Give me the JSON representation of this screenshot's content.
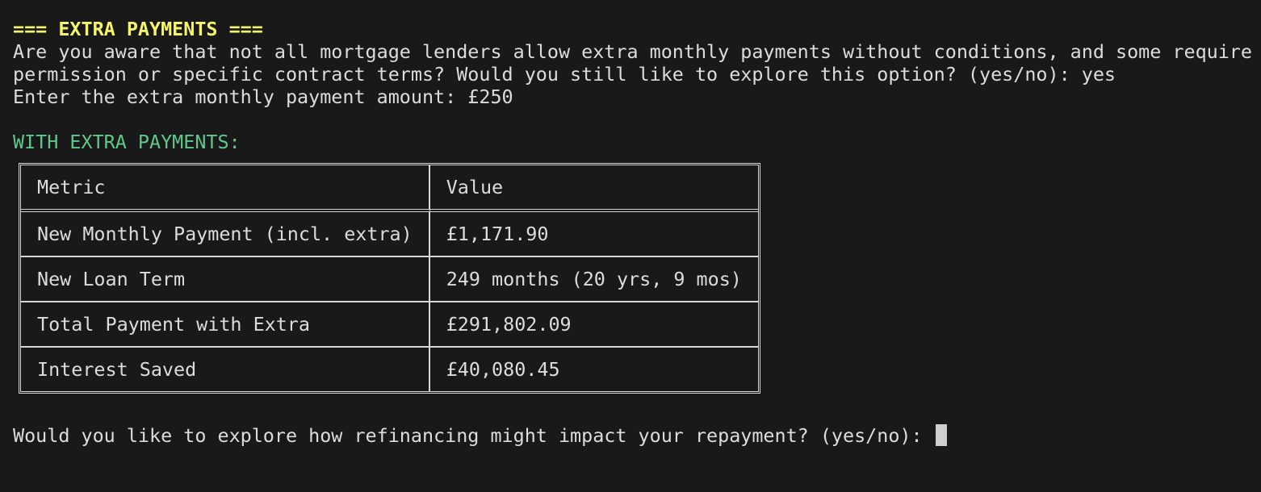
{
  "terminal": {
    "heading": "=== EXTRA PAYMENTS ===",
    "question_line1": "Are you aware that not all mortgage lenders allow extra monthly payments without conditions, and some require",
    "question_line2": "permission or specific contract terms? Would you still like to explore this option? (yes/no): yes",
    "amount_line": "Enter the extra monthly payment amount: £250",
    "section_title": "WITH EXTRA PAYMENTS:",
    "table": {
      "headers": [
        "Metric",
        "Value"
      ],
      "rows": [
        [
          "New Monthly Payment (incl. extra)",
          "£1,171.90"
        ],
        [
          "New Loan Term",
          "249 months (20 yrs, 9 mos)"
        ],
        [
          "Total Payment with Extra",
          "£291,802.09"
        ],
        [
          "Interest Saved",
          "£40,080.45"
        ]
      ]
    },
    "final_prompt": "Would you like to explore how refinancing might impact your repayment? (yes/no): "
  },
  "colors": {
    "background": "#191919",
    "text": "#dcdcdc",
    "heading": "#f5f56b",
    "section": "#5fc98a"
  }
}
